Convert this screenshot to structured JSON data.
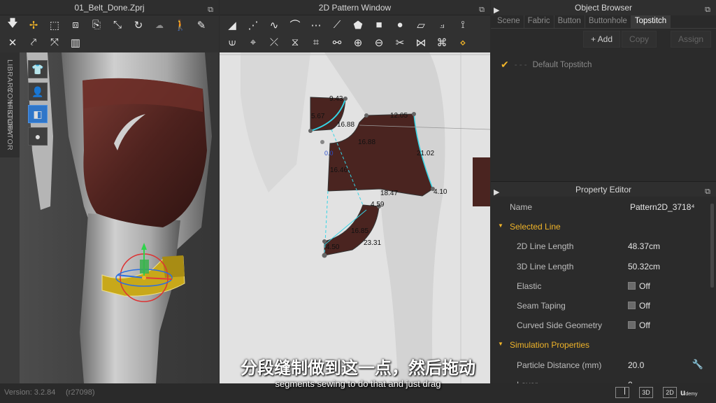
{
  "panel3d": {
    "title": "01_Belt_Done.Zprj",
    "side_tabs": [
      "LIBRARY",
      "HISTORY",
      "CONFIGURATOR"
    ],
    "toolbar_icons": [
      "select-move-icon",
      "gizmo-icon",
      "box-select-icon",
      "transform-icon",
      "fold-icon",
      "tack-icon",
      "avatar-pose-icon",
      "pin-icon",
      "arrange-icon",
      "pin2-icon",
      "sewing-check-icon",
      "strap-icon",
      "measure-icon",
      "cloud-icon"
    ],
    "view_icons": [
      "show-garment-icon",
      "show-avatar-icon",
      "texture-view-icon",
      "avatar-silhouette-icon"
    ]
  },
  "panel2d": {
    "title": "2D Pattern Window",
    "toolbar_icons": [
      "transform-pattern-icon",
      "edit-point-icon",
      "edit-curve-icon",
      "curve-point-icon",
      "add-point-icon",
      "internal-line-icon",
      "polygon-icon",
      "rectangle-icon",
      "circle-icon",
      "trace-icon",
      "segment-sewing-icon",
      "free-sewing-icon",
      "m-n-sewing-icon",
      "notch-icon",
      "fold-arrangement-icon",
      "pleat-icon",
      "texture-edit-icon",
      "graphic-icon",
      "button-icon",
      "buttonhole-icon",
      "topstitch-icon",
      "zipper-icon",
      "elastic-icon",
      "pin-2d-icon"
    ],
    "measurements": [
      "9.43",
      "5.67",
      "12.05",
      "16.88",
      "16.88",
      "21.02",
      "16.46",
      "18.47",
      "4.10",
      "4.59",
      "16.85",
      "23.31",
      "4.50",
      "0.0"
    ]
  },
  "object_browser": {
    "title": "Object Browser",
    "tabs": [
      {
        "label": "Scene",
        "active": false
      },
      {
        "label": "Fabric",
        "active": false
      },
      {
        "label": "Button",
        "active": false
      },
      {
        "label": "Buttonhole",
        "active": false
      },
      {
        "label": "Topstitch",
        "active": true
      }
    ],
    "actions": {
      "add": "+ Add",
      "copy": "Copy",
      "assign": "Assign"
    },
    "items": [
      {
        "label": "Default Topstitch"
      }
    ]
  },
  "property_editor": {
    "title": "Property Editor",
    "name_label": "Name",
    "name_value": "Pattern2D_3718⁴",
    "sections": [
      {
        "label": "Selected Line",
        "rows": [
          {
            "label": "2D Line Length",
            "value": "48.37cm",
            "checkbox": false
          },
          {
            "label": "3D Line Length",
            "value": "50.32cm",
            "checkbox": false
          },
          {
            "label": "Elastic",
            "value": "Off",
            "checkbox": true
          },
          {
            "label": "Seam Taping",
            "value": "Off",
            "checkbox": true
          },
          {
            "label": "Curved Side Geometry",
            "value": "Off",
            "checkbox": true
          }
        ]
      },
      {
        "label": "Simulation Properties",
        "rows": [
          {
            "label": "Particle Distance (mm)",
            "value": "20.0",
            "checkbox": false
          },
          {
            "label": "Layer",
            "value": "0",
            "checkbox": false
          }
        ]
      }
    ]
  },
  "statusbar": {
    "version": "Version: 3.2.84",
    "build": "(r27098)",
    "view_buttons": [
      "split",
      "3D",
      "2D"
    ],
    "brand": "u",
    "brand_small": "demy"
  },
  "subtitles": {
    "chinese": "分段缝制做到这一点，然后拖动",
    "english": "segments sewing to do that and just drag"
  },
  "colors": {
    "accent": "#f0b429",
    "fabric": "#4a2420",
    "seam": "#35d5e6",
    "canvas": "#e2e2e2"
  }
}
